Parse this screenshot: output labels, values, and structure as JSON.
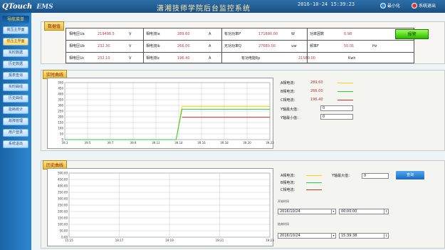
{
  "header": {
    "logo": "QTouch",
    "ems": "EMS",
    "title": "潇湘技师学院后台监控系统",
    "datetime": "2016-10-24 15:39:23",
    "minimize_label": "最小化",
    "exit_label": "系统退出"
  },
  "sidebar": {
    "title": "导航菜单",
    "items": [
      {
        "label": "高压主界面"
      },
      {
        "label": "低压主界面"
      },
      {
        "label": "实时数据"
      },
      {
        "label": "历史数据"
      },
      {
        "label": "报表查询"
      },
      {
        "label": "实时曲线"
      },
      {
        "label": "历史曲线"
      },
      {
        "label": "能耗统计"
      },
      {
        "label": "故障管理"
      },
      {
        "label": "用户登录"
      },
      {
        "label": "系统退出"
      }
    ]
  },
  "measurement": {
    "tab": "数据值",
    "rows": [
      {
        "v_label": "相电压Ua",
        "v_val": "219498.5",
        "v_unit": "V",
        "i_label": "相电流Ia",
        "i_val": "289.60",
        "i_unit": "A",
        "p_label": "有功功率P",
        "p_val": "171680.00",
        "p_unit": "W",
        "x_label": "功率因数",
        "x_val": "0.98",
        "x_unit": ""
      },
      {
        "v_label": "相电压Ub",
        "v_val": "232.30",
        "v_unit": "V",
        "i_label": "相电流Ib",
        "i_val": "266.00",
        "i_unit": "A",
        "p_label": "无功功率Q",
        "p_val": "27680.00",
        "p_unit": "var",
        "x_label": "频率F",
        "x_val": "50.01",
        "x_unit": "Hz"
      },
      {
        "v_label": "相电压Uc",
        "v_val": "232.10",
        "v_unit": "V",
        "i_label": "相电流Ic",
        "i_val": "196.40",
        "i_unit": "A",
        "p_label": "有功电能Ep",
        "p_val": "21580.00",
        "p_unit": "Kwh",
        "x_label": "",
        "x_val": "",
        "x_unit": ""
      }
    ],
    "alarm_label": "报警"
  },
  "realtime": {
    "tab": "实时曲线",
    "legend": [
      {
        "label": "A相电流：",
        "value": "289.60",
        "color": "#ffd400"
      },
      {
        "label": "B相电流：",
        "value": "266.00",
        "color": "#2ecc40"
      },
      {
        "label": "C相电流：",
        "value": "196.40",
        "color": "#c0392b"
      }
    ],
    "ymax_label": "Y轴最大值：",
    "ymax_value": "0",
    "ymin_label": "Y轴最小值：",
    "ymin_value": "0"
  },
  "history": {
    "tab": "历史曲线",
    "legend": [
      {
        "label": "A相电流：",
        "color": "#ffd400"
      },
      {
        "label": "B相电流：",
        "color": "#2ecc40"
      },
      {
        "label": "C相电流：",
        "color": "#c0392b"
      }
    ],
    "ymax_label": "Y轴最大值：",
    "ymax_value": "0",
    "query_label": "查询",
    "start_label": "开始时间",
    "end_label": "结束时间",
    "start_date": "2016/10/24",
    "start_time": "00:00:00",
    "end_date": "2016/10/24",
    "end_time": "15:39:38"
  },
  "chart_data": [
    {
      "type": "line",
      "ylim": [
        0,
        500
      ],
      "yticks": [
        "0",
        "50",
        "100",
        "150",
        "200",
        "250",
        "300",
        "350",
        "400",
        "450",
        "500"
      ],
      "xticks": [
        "39.3",
        "39.5",
        "39.7",
        "39.9",
        "39.11",
        "39.14",
        "39.16",
        "39.18",
        "39.20",
        "39.23"
      ],
      "series": [
        {
          "name": "A相电流",
          "color": "#ffd400",
          "values": [
            0,
            0,
            0,
            0,
            0,
            0,
            0,
            0,
            0,
            0,
            0,
            0,
            0,
            0,
            0,
            0,
            0,
            0,
            0,
            0,
            290,
            290,
            290,
            290,
            290,
            290,
            290,
            290,
            290,
            290,
            290,
            290,
            290,
            290,
            290,
            290
          ]
        },
        {
          "name": "B相电流",
          "color": "#2ecc40",
          "values": [
            0,
            0,
            0,
            0,
            0,
            0,
            0,
            0,
            0,
            0,
            0,
            0,
            0,
            0,
            0,
            0,
            0,
            0,
            0,
            0,
            266,
            266,
            266,
            266,
            266,
            266,
            266,
            266,
            266,
            266,
            266,
            266,
            266,
            266,
            266,
            266
          ]
        },
        {
          "name": "C相电流",
          "color": "#c0392b",
          "values": [
            null,
            null,
            null,
            null,
            null,
            null,
            null,
            null,
            null,
            null,
            null,
            null,
            null,
            null,
            null,
            null,
            null,
            null,
            null,
            null,
            196,
            196,
            196,
            196,
            196,
            196,
            196,
            196,
            196,
            196,
            196,
            196,
            196,
            196,
            196,
            196
          ]
        }
      ]
    },
    {
      "type": "line",
      "ylim": [
        0,
        500
      ],
      "yticks": [
        "0.00",
        "50.00",
        "100.00",
        "150.00",
        "200.00",
        "250.00",
        "300.00",
        "350.00",
        "400.00",
        "450.00",
        "500.00"
      ],
      "xticks": [
        "15:15",
        "19:17",
        "19:19",
        "19:21",
        "19:23"
      ],
      "series": []
    }
  ]
}
